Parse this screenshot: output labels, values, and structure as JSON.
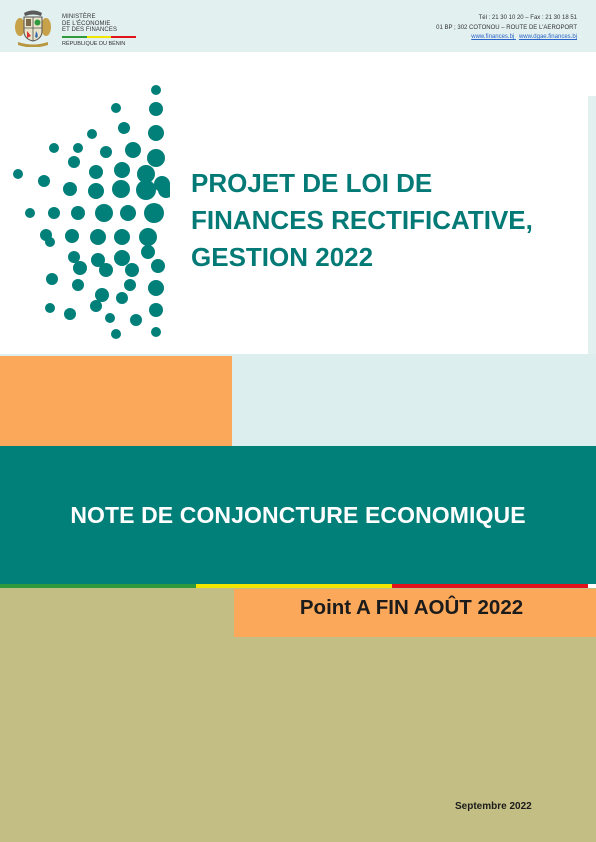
{
  "header": {
    "ministry_lines": [
      "Ministère",
      "de l'Économie",
      "et des Finances"
    ],
    "republic": "République du Bénin",
    "contact_line1": "Tél : 21 30 10 20 – Fax : 21 30 18 51",
    "contact_line2": "01 BP ; 302 COTONOU – ROUTE DE L'AEROPORT",
    "link1": "www.finances.bj",
    "link2": "www.dgae.finances.bj"
  },
  "title_lines": [
    "PROJET DE LOI DE",
    "FINANCES RECTIFICATIVE,",
    "GESTION 2022"
  ],
  "note_title": "NOTE DE CONJONCTURE ECONOMIQUE",
  "point": "Point A FIN AOÛT 2022",
  "date": "Septembre 2022",
  "colors": {
    "teal": "#017f79",
    "title_teal": "#037a76",
    "orange": "#fba85a",
    "olive": "#c3be84",
    "light": "#dceeed",
    "flag_green": "#2e9a3c",
    "flag_yellow": "#f2e600",
    "flag_red": "#e2141b"
  },
  "icons": [
    "benin-coat-of-arms-icon",
    "dots-pattern-icon"
  ]
}
